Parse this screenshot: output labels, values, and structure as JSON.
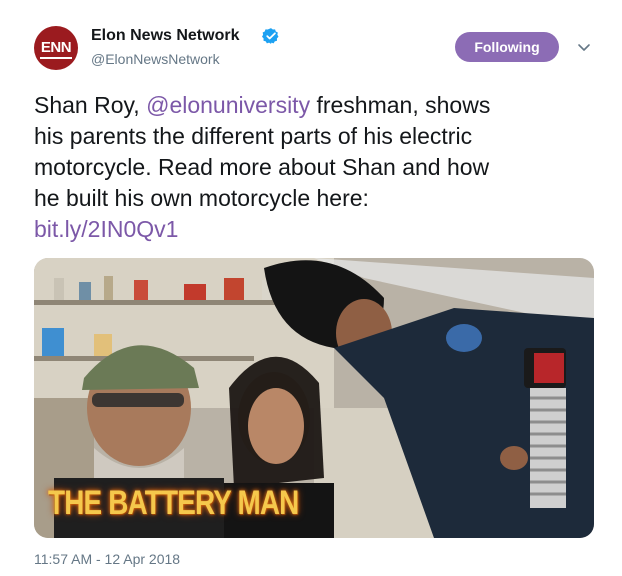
{
  "author": {
    "display_name": "Elon News Network",
    "handle": "@ElonNewsNetwork",
    "avatar_text": "ENN",
    "verified_icon": "verified-badge-icon",
    "brand_color": "#9b1b1f"
  },
  "actions": {
    "follow_label": "Following",
    "follow_color": "#8c6cb5",
    "more_icon": "chevron-down-icon"
  },
  "tweet": {
    "text_segments": {
      "l1_a": "Shan Roy, ",
      "l1_mention": "@elonuniversity",
      "l1_b": " freshman, shows",
      "l2": "his parents the different parts of his electric",
      "l3": "motorcycle. Read more about Shan and how",
      "l4": "he built his own motorcycle here:",
      "link": "bit.ly/2IN0Qv1"
    },
    "link_color": "#7c58a8"
  },
  "media": {
    "overlay_title": "THE BATTERY MAN"
  },
  "meta": {
    "timestamp": "11:57 AM - 12 Apr 2018"
  }
}
